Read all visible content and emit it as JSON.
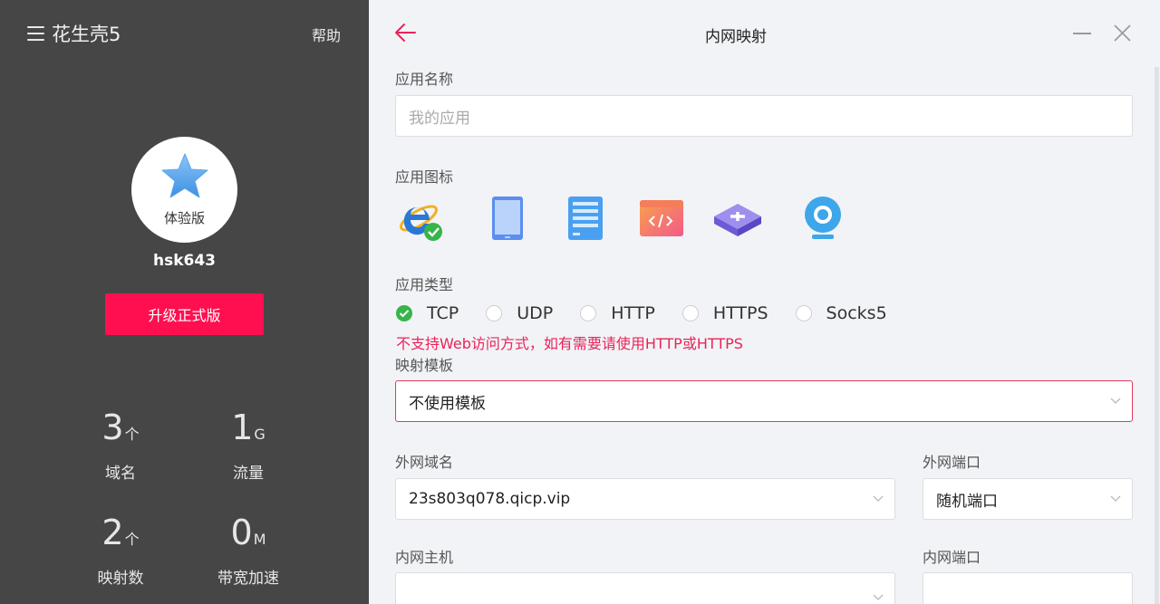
{
  "sidebar": {
    "app_name": "花生壳5",
    "help": "帮助",
    "avatar_badge": "体验版",
    "username": "hsk643",
    "upgrade": "升级正式版",
    "stats": [
      {
        "num": "3",
        "unit": "个",
        "label": "域名"
      },
      {
        "num": "1",
        "unit": "G",
        "label": "流量"
      },
      {
        "num": "2",
        "unit": "个",
        "label": "映射数"
      },
      {
        "num": "0",
        "unit": "M",
        "label": "带宽加速"
      }
    ]
  },
  "header": {
    "title": "内网映射"
  },
  "form": {
    "app_name_label": "应用名称",
    "app_name_placeholder": "我的应用",
    "app_icon_label": "应用图标",
    "app_type_label": "应用类型",
    "types": [
      "TCP",
      "UDP",
      "HTTP",
      "HTTPS",
      "Socks5"
    ],
    "warning": "不支持Web访问方式，如有需要请使用HTTP或HTTPS",
    "template_label": "映射模板",
    "template_value": "不使用模板",
    "domain_label": "外网域名",
    "domain_value": "23s803q078.qicp.vip",
    "ext_port_label": "外网端口",
    "ext_port_value": "随机端口",
    "host_label": "内网主机",
    "host_value": "",
    "int_port_label": "内网端口",
    "int_port_value": ""
  },
  "colors": {
    "accent": "#ff0f50",
    "check": "#38b44a",
    "warning": "#e8245a",
    "sidebar": "#464646"
  }
}
